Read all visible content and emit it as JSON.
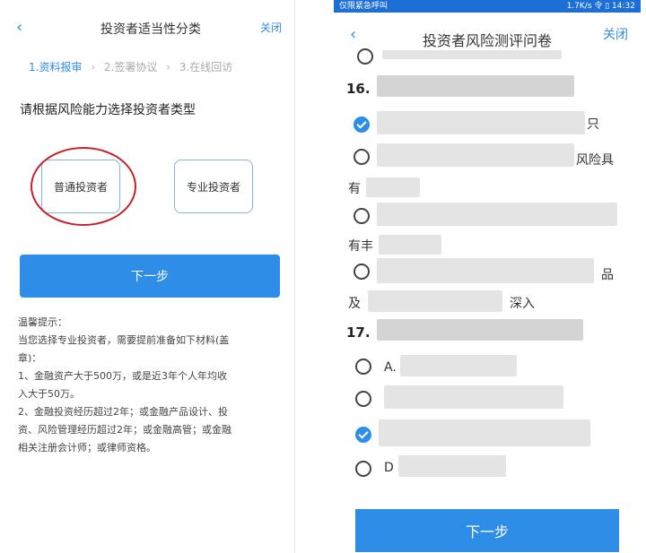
{
  "left": {
    "header": {
      "back_icon": "chevron-left-icon",
      "title": "投资者适当性分类",
      "close": "关闭"
    },
    "steps": [
      "1.资料报审",
      "2.签署协议",
      "3.在线回访"
    ],
    "prompt": "请根据风险能力选择投资者类型",
    "options": {
      "normal": "普通投资者",
      "pro": "专业投资者"
    },
    "next": "下一步",
    "tips": [
      "温馨提示：",
      "当您选择专业投资者，需要提前准备如下材料(盖",
      "章)：",
      "1、金融资产大于500万，或是近3年个人年均收",
      "入大于50万。",
      "2、金融投资经历超过2年；或金融产品设计、投",
      "资、风险管理经历超过2年；或金融高管；或金融",
      "相关注册会计师；或律师资格。"
    ]
  },
  "right": {
    "status": {
      "left": "仅限紧急呼叫",
      "right": "1.7K/s 令 ▯ 14:32"
    },
    "header": {
      "back_icon": "chevron-left-icon",
      "title": "投资者风险测评问卷",
      "close": "关闭"
    },
    "q16": "16.",
    "q17": "17.",
    "frags": {
      "a1": "只",
      "a2": "风险具",
      "a3": "有",
      "a4": "有丰",
      "a5": "品",
      "a6": "及",
      "a7": "深入",
      "b1": "A.",
      "b4": "D"
    },
    "next": "下一步"
  },
  "colors": {
    "accent": "#2e8de6",
    "annotation": "#c8202a"
  }
}
